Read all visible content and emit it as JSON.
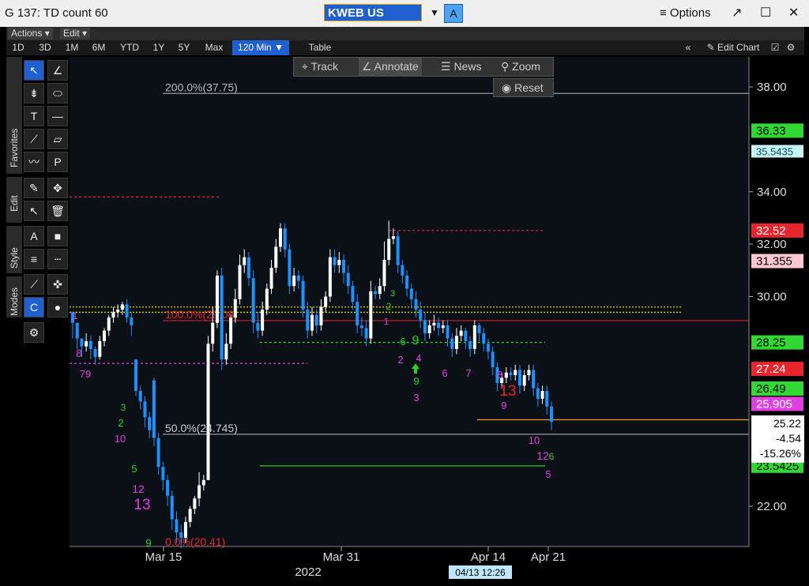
{
  "window": {
    "title": "G 137: TD count 60",
    "ticker": "KWEB US Equity",
    "ticker_button": "A",
    "options_label": "Options"
  },
  "menu": {
    "actions": "Actions",
    "edit": "Edit"
  },
  "periods": {
    "items": [
      "1D",
      "3D",
      "1M",
      "6M",
      "YTD",
      "1Y",
      "5Y",
      "Max",
      "120 Min",
      "Table"
    ],
    "active": "120 Min",
    "edit_chart": "Edit Chart"
  },
  "side_tabs": {
    "favorites": "Favorites",
    "edit": "Edit",
    "style": "Style",
    "modes": "Modes"
  },
  "chart_toolbar": {
    "track": "Track",
    "annotate": "Annotate",
    "news": "News",
    "zoom": "Zoom",
    "reset": "Reset"
  },
  "colors": {
    "bg": "#0b1016",
    "up": "#ffffff",
    "down": "#1e90ff",
    "accent_blue": "#1f5fd0",
    "red_level": "#e8242c",
    "green_level": "#2bd12b",
    "magenta": "#e040e0"
  },
  "chart_data": {
    "type": "candlestick",
    "security": "KWEB US Equity",
    "interval": "120 Min",
    "ylim": [
      20.4,
      39.0
    ],
    "y_ticks": [
      "38.00",
      "34.00",
      "32.00",
      "30.00",
      "22.00"
    ],
    "x_ticks": [
      "Mar 15",
      "Mar 31",
      "Apr 14",
      "Apr 21"
    ],
    "x_year": "2022",
    "crosshair_date": "04/13 12:26",
    "fibonacci": [
      {
        "label": "200.0%(37.75)",
        "value": 37.75
      },
      {
        "label": "100.0%(29.08)",
        "value": 29.08
      },
      {
        "label": "50.0%(24.745)",
        "value": 24.745
      },
      {
        "label": "0.0%(20.41)",
        "value": 20.41
      }
    ],
    "price_labels": [
      {
        "value": 36.33,
        "text": "36.33",
        "color": "green"
      },
      {
        "value": 35.5435,
        "text": "35.5435",
        "color": "cyan"
      },
      {
        "value": 32.52,
        "text": "32.52",
        "color": "red"
      },
      {
        "value": 31.355,
        "text": "31.355",
        "color": "pink"
      },
      {
        "value": 28.25,
        "text": "28.25",
        "color": "green"
      },
      {
        "value": 27.24,
        "text": "27.24",
        "color": "red"
      },
      {
        "value": 26.49,
        "text": "26.49",
        "color": "green"
      },
      {
        "value": 25.905,
        "text": "25.905",
        "color": "magenta"
      },
      {
        "value": 23.5425,
        "text": "23.5425",
        "color": "green"
      }
    ],
    "last_price": {
      "price": "25.22",
      "change": "-4.54",
      "pct_change": "-15.26%"
    },
    "levels": [
      {
        "value": 33.8,
        "from": 0,
        "to": 0.22,
        "style": "red-dotted"
      },
      {
        "value": 32.52,
        "from": 0.47,
        "to": 0.7,
        "style": "red-dotted"
      },
      {
        "value": 29.6,
        "from": 0,
        "to": 0.9,
        "style": "yellow-dotted"
      },
      {
        "value": 29.4,
        "from": 0,
        "to": 0.9,
        "style": "yellow-dotted"
      },
      {
        "value": 28.25,
        "from": 0.28,
        "to": 0.7,
        "style": "green-dotted"
      },
      {
        "value": 27.45,
        "from": 0,
        "to": 0.35,
        "style": "magenta-dotted"
      },
      {
        "value": 23.54,
        "from": 0.28,
        "to": 0.7,
        "style": "green-solid"
      },
      {
        "value": 25.3,
        "from": 0.6,
        "to": 1.0,
        "style": "orange-solid"
      }
    ],
    "candles": [
      [
        29.4,
        29.0,
        28.4,
        29.0
      ],
      [
        29.0,
        28.4,
        28.0,
        28.7
      ],
      [
        28.4,
        28.1,
        27.7,
        28.4
      ],
      [
        28.1,
        28.3,
        27.9,
        28.6
      ],
      [
        28.3,
        28.0,
        27.6,
        28.5
      ],
      [
        28.0,
        27.7,
        27.4,
        28.1
      ],
      [
        27.7,
        28.3,
        27.6,
        28.5
      ],
      [
        28.3,
        28.7,
        28.1,
        28.8
      ],
      [
        28.7,
        29.2,
        28.5,
        29.3
      ],
      [
        29.2,
        29.4,
        29.0,
        29.6
      ],
      [
        29.4,
        29.5,
        29.2,
        29.7
      ],
      [
        29.5,
        29.7,
        29.3,
        29.8
      ],
      [
        29.7,
        29.2,
        29.0,
        29.9
      ],
      [
        29.2,
        28.9,
        28.5,
        29.4
      ],
      [
        27.6,
        26.4,
        26.2,
        27.6
      ],
      [
        26.4,
        26.0,
        25.7,
        26.6
      ],
      [
        26.0,
        25.4,
        25.0,
        26.2
      ],
      [
        25.4,
        24.9,
        24.6,
        25.6
      ],
      [
        26.8,
        24.6,
        24.3,
        26.9
      ],
      [
        24.6,
        23.5,
        23.2,
        24.8
      ],
      [
        23.5,
        23.0,
        22.6,
        23.7
      ],
      [
        23.0,
        22.4,
        22.0,
        23.2
      ],
      [
        22.4,
        21.5,
        21.1,
        22.6
      ],
      [
        21.5,
        21.0,
        20.6,
        21.8
      ],
      [
        21.0,
        20.8,
        20.4,
        21.3
      ],
      [
        20.8,
        21.4,
        20.6,
        21.6
      ],
      [
        21.4,
        21.9,
        21.2,
        22.0
      ],
      [
        21.9,
        22.3,
        21.7,
        22.4
      ],
      [
        22.3,
        22.8,
        22.0,
        23.3
      ],
      [
        22.8,
        23.0,
        22.6,
        23.2
      ],
      [
        23.0,
        28.2,
        26.8,
        28.5
      ],
      [
        28.2,
        29.0,
        27.9,
        29.6
      ],
      [
        29.0,
        30.8,
        28.8,
        31.0
      ],
      [
        30.8,
        27.6,
        27.2,
        31.1
      ],
      [
        27.6,
        28.2,
        27.4,
        28.6
      ],
      [
        28.2,
        29.2,
        28.0,
        29.3
      ],
      [
        29.2,
        29.9,
        29.0,
        30.3
      ],
      [
        29.9,
        31.2,
        29.7,
        31.6
      ],
      [
        31.2,
        31.5,
        30.9,
        31.8
      ],
      [
        31.5,
        30.7,
        30.4,
        31.7
      ],
      [
        30.7,
        29.0,
        28.6,
        31.0
      ],
      [
        29.0,
        28.7,
        28.4,
        29.4
      ],
      [
        28.7,
        29.5,
        28.5,
        29.8
      ],
      [
        29.5,
        30.3,
        29.3,
        30.5
      ],
      [
        30.3,
        31.1,
        30.1,
        31.4
      ],
      [
        31.1,
        31.9,
        30.9,
        32.2
      ],
      [
        31.9,
        32.6,
        31.7,
        32.8
      ],
      [
        32.6,
        31.8,
        31.5,
        32.8
      ],
      [
        31.8,
        30.4,
        30.1,
        32.0
      ],
      [
        30.4,
        30.8,
        30.2,
        31.1
      ],
      [
        30.8,
        30.6,
        30.3,
        31.0
      ],
      [
        30.6,
        29.5,
        29.2,
        30.8
      ],
      [
        29.5,
        28.7,
        28.4,
        29.8
      ],
      [
        28.7,
        29.3,
        28.5,
        29.6
      ],
      [
        29.3,
        28.9,
        28.6,
        29.5
      ],
      [
        28.9,
        29.6,
        28.7,
        29.9
      ],
      [
        29.6,
        30.0,
        29.4,
        30.2
      ],
      [
        30.0,
        31.5,
        29.8,
        31.8
      ],
      [
        31.5,
        31.2,
        30.9,
        31.8
      ],
      [
        31.2,
        31.4,
        30.9,
        31.7
      ],
      [
        31.4,
        30.9,
        30.5,
        31.6
      ],
      [
        30.9,
        30.4,
        30.1,
        31.2
      ],
      [
        30.4,
        29.8,
        29.5,
        30.6
      ],
      [
        29.8,
        28.9,
        28.6,
        30.1
      ],
      [
        28.9,
        28.8,
        28.5,
        29.2
      ],
      [
        28.8,
        28.4,
        28.1,
        29.1
      ],
      [
        28.4,
        30.2,
        28.2,
        30.6
      ],
      [
        30.2,
        30.1,
        29.9,
        30.4
      ],
      [
        30.1,
        30.4,
        29.9,
        30.7
      ],
      [
        30.4,
        31.4,
        30.2,
        32.1
      ],
      [
        31.4,
        32.2,
        31.2,
        32.9
      ],
      [
        32.2,
        32.3,
        32.0,
        32.6
      ],
      [
        32.3,
        31.2,
        30.9,
        32.5
      ],
      [
        31.2,
        30.8,
        30.5,
        31.4
      ],
      [
        30.8,
        30.3,
        30.0,
        31.0
      ],
      [
        30.3,
        29.9,
        29.6,
        30.5
      ],
      [
        29.9,
        29.5,
        29.2,
        30.2
      ],
      [
        29.5,
        29.1,
        28.8,
        29.8
      ],
      [
        29.1,
        28.6,
        28.3,
        29.4
      ],
      [
        28.6,
        28.9,
        28.4,
        29.1
      ],
      [
        28.9,
        29.0,
        28.7,
        29.3
      ],
      [
        29.0,
        28.8,
        28.5,
        29.2
      ],
      [
        28.8,
        28.9,
        28.6,
        29.1
      ],
      [
        28.9,
        28.4,
        28.1,
        29.1
      ],
      [
        28.4,
        28.0,
        27.7,
        28.6
      ],
      [
        28.0,
        28.5,
        27.8,
        28.8
      ],
      [
        28.5,
        28.7,
        28.3,
        28.9
      ],
      [
        28.7,
        28.3,
        28.0,
        28.8
      ],
      [
        28.3,
        28.0,
        27.7,
        28.5
      ],
      [
        28.0,
        28.9,
        27.8,
        29.1
      ],
      [
        28.9,
        28.6,
        28.3,
        29.0
      ],
      [
        28.6,
        28.2,
        27.9,
        28.8
      ],
      [
        28.2,
        27.9,
        27.6,
        28.4
      ],
      [
        27.9,
        27.3,
        27.0,
        28.1
      ],
      [
        27.3,
        26.7,
        26.4,
        27.5
      ],
      [
        26.7,
        26.9,
        26.5,
        27.1
      ],
      [
        26.9,
        27.1,
        26.7,
        27.3
      ],
      [
        27.1,
        27.0,
        26.8,
        27.3
      ],
      [
        27.0,
        27.2,
        26.8,
        27.4
      ],
      [
        27.2,
        26.6,
        26.3,
        27.4
      ],
      [
        26.6,
        27.0,
        26.4,
        27.2
      ],
      [
        27.0,
        27.2,
        26.8,
        27.4
      ],
      [
        27.2,
        26.5,
        26.2,
        27.4
      ],
      [
        26.5,
        26.1,
        25.8,
        26.7
      ],
      [
        26.1,
        26.4,
        25.9,
        26.6
      ],
      [
        26.4,
        25.8,
        25.5,
        26.6
      ],
      [
        25.8,
        25.22,
        24.9,
        26.0
      ]
    ],
    "td_counts": [
      {
        "x": 95,
        "y": 404,
        "t": "1",
        "c": "#e040e0",
        "s": 12
      },
      {
        "x": 100,
        "y": 452,
        "t": "8",
        "c": "#e040e0",
        "s": 14
      },
      {
        "x": 108,
        "y": 478,
        "t": "79",
        "c": "#e040e0",
        "s": 13
      },
      {
        "x": 152,
        "y": 560,
        "t": "10",
        "c": "#e040e0",
        "s": 13
      },
      {
        "x": 170,
        "y": 598,
        "t": "5",
        "c": "#2bd12b",
        "s": 13
      },
      {
        "x": 175,
        "y": 624,
        "t": "12",
        "c": "#e040e0",
        "s": 14
      },
      {
        "x": 180,
        "y": 645,
        "t": "13",
        "c": "#e040e0",
        "s": 19
      },
      {
        "x": 188,
        "y": 692,
        "t": "9",
        "c": "#2bd12b",
        "s": 13
      },
      {
        "x": 153,
        "y": 540,
        "t": "2",
        "c": "#2bd12b",
        "s": 13
      },
      {
        "x": 156,
        "y": 520,
        "t": "3",
        "c": "#2bd12b",
        "s": 12
      },
      {
        "x": 489,
        "y": 411,
        "t": "1",
        "c": "#e040e0",
        "s": 12
      },
      {
        "x": 507,
        "y": 460,
        "t": "2",
        "c": "#e040e0",
        "s": 13
      },
      {
        "x": 510,
        "y": 437,
        "t": "6",
        "c": "#2bd12b",
        "s": 13
      },
      {
        "x": 526,
        "y": 436,
        "t": "9",
        "c": "#2bd12b",
        "s": 16
      },
      {
        "x": 530,
        "y": 458,
        "t": "4",
        "c": "#e040e0",
        "s": 13
      },
      {
        "x": 527,
        "y": 487,
        "t": "9",
        "c": "#2bd12b",
        "s": 13
      },
      {
        "x": 527,
        "y": 508,
        "t": "3",
        "c": "#e040e0",
        "s": 13
      },
      {
        "x": 563,
        "y": 477,
        "t": "6",
        "c": "#e040e0",
        "s": 13
      },
      {
        "x": 593,
        "y": 477,
        "t": "7",
        "c": "#e040e0",
        "s": 13
      },
      {
        "x": 633,
        "y": 479,
        "t": "8",
        "c": "#e040e0",
        "s": 13
      },
      {
        "x": 643,
        "y": 501,
        "t": "13",
        "c": "#e8242c",
        "s": 19
      },
      {
        "x": 638,
        "y": 518,
        "t": "9",
        "c": "#e040e0",
        "s": 13
      },
      {
        "x": 676,
        "y": 562,
        "t": "10",
        "c": "#e040e0",
        "s": 13
      },
      {
        "x": 687,
        "y": 582,
        "t": "12",
        "c": "#e040e0",
        "s": 14
      },
      {
        "x": 694,
        "y": 605,
        "t": "5",
        "c": "#e040e0",
        "s": 13
      },
      {
        "x": 698,
        "y": 582,
        "t": "6",
        "c": "#2bd12b",
        "s": 12
      },
      {
        "x": 492,
        "y": 392,
        "t": "2",
        "c": "#2bd12b",
        "s": 12
      },
      {
        "x": 497,
        "y": 375,
        "t": "3",
        "c": "#2bd12b",
        "s": 11
      }
    ]
  }
}
